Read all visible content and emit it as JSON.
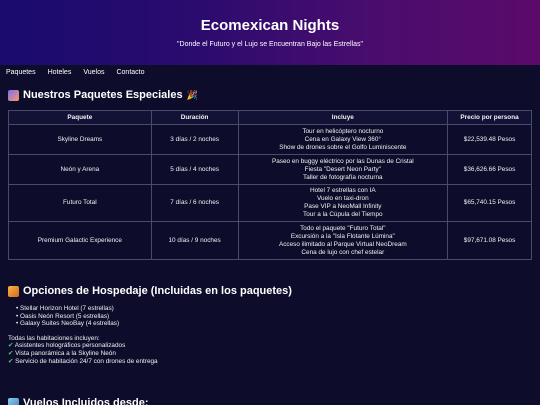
{
  "hero": {
    "title": "Ecomexican Nights",
    "tagline": "\"Donde el Futuro y el Lujo se Encuentran Bajo las Estrellas\""
  },
  "nav": {
    "items": [
      "Paquetes",
      "Hoteles",
      "Vuelos",
      "Contacto"
    ]
  },
  "packages_section": {
    "title": "Nuestros Paquetes Especiales",
    "icon_left": "rocket-icon",
    "icon_right": "party-popper-icon",
    "headers": [
      "Paquete",
      "Duración",
      "Incluye",
      "Precio por persona"
    ],
    "rows": [
      {
        "name": "Skyline Dreams",
        "duration": "3 días / 2 noches",
        "includes": [
          "Tour en helicóptero nocturno",
          "Cena en Galaxy View 360°",
          "Show de drones sobre el Golfo Luminiscente"
        ],
        "price": "$22,539.48 Pesos"
      },
      {
        "name": "Neón y Arena",
        "duration": "5 días / 4 noches",
        "includes": [
          "Paseo en buggy eléctrico por las Dunas de Cristal",
          "Fiesta \"Desert Neon Party\"",
          "Taller de fotografía nocturna"
        ],
        "price": "$36,626.66 Pesos"
      },
      {
        "name": "Futuro Total",
        "duration": "7 días / 6 noches",
        "includes": [
          "Hotel 7 estrellas con IA",
          "Vuelo en taxi-dron",
          "Pase VIP a NeoMall Infinity",
          "Tour a la Cúpula del Tiempo"
        ],
        "price": "$65,740.15 Pesos"
      },
      {
        "name": "Premium Galactic Experience",
        "duration": "10 días / 9 noches",
        "includes": [
          "Todo el paquete \"Futuro Total\"",
          "Excursión a la \"Isla Flotante Lúmina\"",
          "Acceso ilimitado al Parque Virtual NeoDream",
          "Cena de lujo con chef estelar"
        ],
        "price": "$97,671.08 Pesos"
      }
    ]
  },
  "lodging_section": {
    "title": "Opciones de Hospedaje (Incluidas en los paquetes)",
    "icon": "hotel-icon",
    "hotels": [
      "Stellar Horizon Hotel (7 estrellas)",
      "Oasis Neón Resort (5 estrellas)",
      "Galaxy Suites NeoBay (4 estrellas)"
    ],
    "amenities_intro": "Todas las habitaciones incluyen:",
    "amenities": [
      "Asistentes holográficos personalizados",
      "Vista panorámica a la Skyline Neón",
      "Servicio de habitación 24/7 con drones de entrega"
    ],
    "check_icon": "check-mark-icon"
  },
  "flights_section": {
    "title": "Vuelos Incluidos desde:",
    "icon": "airplane-icon"
  }
}
